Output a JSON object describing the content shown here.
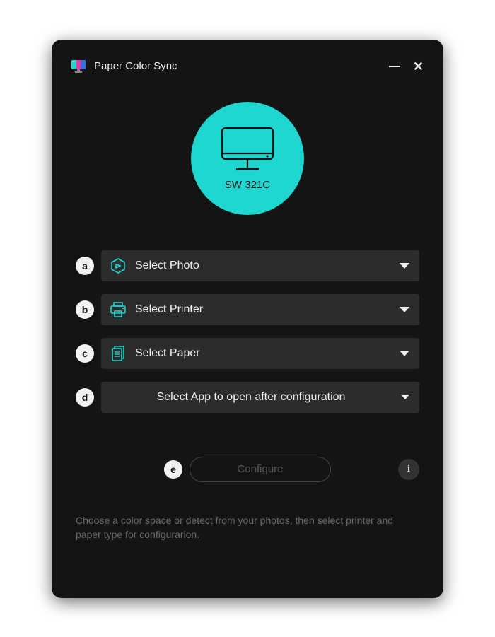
{
  "window": {
    "title": "Paper Color Sync"
  },
  "monitor": {
    "model": "SW 321C"
  },
  "steps": {
    "a": {
      "badge": "a",
      "label": "Select Photo"
    },
    "b": {
      "badge": "b",
      "label": "Select Printer"
    },
    "c": {
      "badge": "c",
      "label": "Select Paper"
    },
    "d": {
      "badge": "d",
      "label": "Select App to open after configuration"
    }
  },
  "configure": {
    "badge": "e",
    "label": "Configure",
    "info": "i"
  },
  "hint": "Choose a color space or detect from your photos, then select printer and paper type for configurarion."
}
